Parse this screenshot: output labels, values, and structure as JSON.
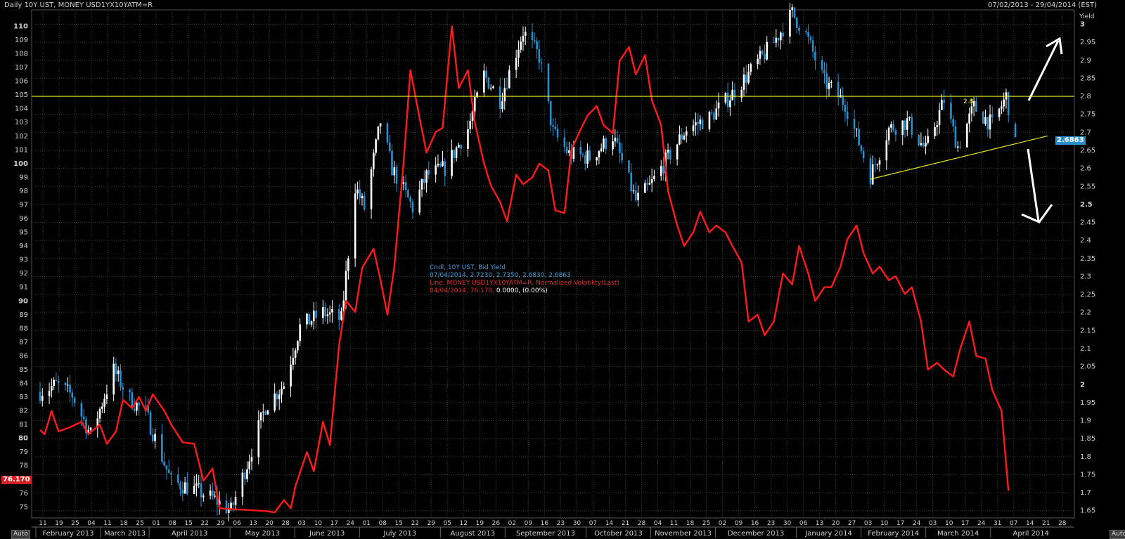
{
  "header": {
    "title": "Daily 10Y UST, MONEY USD1YX10YATM=R",
    "range": "07/02/2013 - 29/04/2014 (EST)"
  },
  "legend": {
    "line1": "Cndl, 10Y UST, Bid Yield",
    "line2": "07/04/2014, 2.7230, 2.7350, 2.6830, 2.6863",
    "line3": "Line, MONEY USD1YX10YATM=R, Normalized Volatility(Last)",
    "line4_date": "04/04/2014, 76.170,",
    "line4_rest": " 0.0000, (0.00%)"
  },
  "buttons": {
    "auto_left": "Auto",
    "auto_right": "Auto"
  },
  "tags": {
    "right_value": "2.6863",
    "left_value": "76.170",
    "level_label": "2.8"
  },
  "colors": {
    "background": "#000000",
    "grid": "#3c3c3c",
    "candle_up": "#ffffff",
    "candle_down": "#2a8fcf",
    "vol_line": "#ff1a1a",
    "level_line": "#e8e820",
    "trend_line": "#e8e820",
    "arrow": "#ffffff"
  },
  "chart_data": {
    "type": "line",
    "title": "Daily 10Y UST, MONEY USD1YX10YATM=R",
    "right_axis": {
      "label": "Yield",
      "ticks": [
        "3",
        "2.95",
        "2.9",
        "2.85",
        "2.8",
        "2.75",
        "2.7",
        "2.65",
        "2.6",
        "2.55",
        "2.5",
        "2.45",
        "2.4",
        "2.35",
        "2.3",
        "2.25",
        "2.2",
        "2.15",
        "2.1",
        "2.05",
        "2",
        "1.95",
        "1.9",
        "1.85",
        "1.8",
        "1.75",
        "1.7",
        "1.65"
      ],
      "bold_ticks": [
        "3",
        "2.5",
        "2"
      ],
      "range": [
        1.63,
        3.04
      ]
    },
    "left_axis": {
      "ticks": [
        "110",
        "109",
        "108",
        "107",
        "106",
        "105",
        "104",
        "103",
        "102",
        "101",
        "100",
        "99",
        "98",
        "97",
        "96",
        "95",
        "94",
        "93",
        "92",
        "91",
        "90",
        "89",
        "88",
        "87",
        "86",
        "85",
        "84",
        "83",
        "82",
        "81",
        "80",
        "79",
        "78",
        "77",
        "76",
        "75"
      ],
      "bold_ticks": [
        "110",
        "100",
        "90",
        "80"
      ],
      "range": [
        74.2,
        111.2
      ]
    },
    "x_ticks": [
      "11",
      "19",
      "25",
      "04",
      "11",
      "18",
      "25",
      "01",
      "08",
      "15",
      "22",
      "29",
      "06",
      "13",
      "20",
      "28",
      "03",
      "10",
      "17",
      "24",
      "01",
      "08",
      "15",
      "22",
      "29",
      "05",
      "12",
      "19",
      "26",
      "02",
      "09",
      "16",
      "23",
      "30",
      "07",
      "14",
      "21",
      "28",
      "04",
      "11",
      "18",
      "25",
      "02",
      "09",
      "16",
      "23",
      "30",
      "06",
      "13",
      "20",
      "27",
      "03",
      "10",
      "17",
      "24",
      "03",
      "10",
      "17",
      "24",
      "31",
      "07",
      "14",
      "21",
      "28"
    ],
    "months": [
      "February 2013",
      "March 2013",
      "April 2013",
      "May 2013",
      "June 2013",
      "July 2013",
      "August 2013",
      "September 2013",
      "October 2013",
      "November 2013",
      "December 2013",
      "January 2014",
      "February 2014",
      "March 2014",
      "April 2014"
    ],
    "series": [
      {
        "name": "Cndl, 10Y UST, Bid Yield",
        "kind": "candlestick",
        "x_start": "07/02/2013",
        "x_end": "07/04/2014",
        "anchors": [
          [
            "07/02/2013",
            1.98
          ],
          [
            "14/02/2013",
            2.0
          ],
          [
            "21/02/2013",
            1.97
          ],
          [
            "01/03/2013",
            1.86
          ],
          [
            "11/03/2013",
            2.04
          ],
          [
            "18/03/2013",
            1.96
          ],
          [
            "25/03/2013",
            1.92
          ],
          [
            "05/04/2013",
            1.73
          ],
          [
            "15/04/2013",
            1.71
          ],
          [
            "24/04/2013",
            1.68
          ],
          [
            "01/05/2013",
            1.65
          ],
          [
            "08/05/2013",
            1.78
          ],
          [
            "16/05/2013",
            1.94
          ],
          [
            "24/05/2013",
            2.0
          ],
          [
            "31/05/2013",
            2.16
          ],
          [
            "10/06/2013",
            2.2
          ],
          [
            "18/06/2013",
            2.18
          ],
          [
            "24/06/2013",
            2.55
          ],
          [
            "28/06/2013",
            2.49
          ],
          [
            "05/07/2013",
            2.73
          ],
          [
            "10/07/2013",
            2.6
          ],
          [
            "19/07/2013",
            2.49
          ],
          [
            "25/07/2013",
            2.58
          ],
          [
            "02/08/2013",
            2.6
          ],
          [
            "12/08/2013",
            2.71
          ],
          [
            "19/08/2013",
            2.86
          ],
          [
            "26/08/2013",
            2.79
          ],
          [
            "05/09/2013",
            2.98
          ],
          [
            "12/09/2013",
            2.91
          ],
          [
            "18/09/2013",
            2.7
          ],
          [
            "25/09/2013",
            2.64
          ],
          [
            "04/10/2013",
            2.63
          ],
          [
            "14/10/2013",
            2.69
          ],
          [
            "24/10/2013",
            2.51
          ],
          [
            "30/10/2013",
            2.55
          ],
          [
            "07/11/2013",
            2.63
          ],
          [
            "15/11/2013",
            2.71
          ],
          [
            "25/11/2013",
            2.74
          ],
          [
            "04/12/2013",
            2.8
          ],
          [
            "13/12/2013",
            2.87
          ],
          [
            "23/12/2013",
            2.95
          ],
          [
            "31/12/2013",
            3.03
          ],
          [
            "06/01/2014",
            2.97
          ],
          [
            "14/01/2014",
            2.84
          ],
          [
            "23/01/2014",
            2.78
          ],
          [
            "03/02/2014",
            2.58
          ],
          [
            "11/02/2014",
            2.71
          ],
          [
            "19/02/2014",
            2.73
          ],
          [
            "27/02/2014",
            2.65
          ],
          [
            "07/03/2014",
            2.79
          ],
          [
            "13/03/2014",
            2.66
          ],
          [
            "20/03/2014",
            2.77
          ],
          [
            "28/03/2014",
            2.72
          ],
          [
            "03/04/2014",
            2.8
          ],
          [
            "07/04/2014",
            2.6863
          ]
        ],
        "last": {
          "date": "07/04/2014",
          "open": 2.723,
          "high": 2.735,
          "low": 2.683,
          "close": 2.6863
        }
      },
      {
        "name": "Line, MONEY USD1YX10YATM=R, Normalized Volatility(Last)",
        "kind": "line",
        "points": [
          [
            "07/02/2013",
            80.6
          ],
          [
            "09/02/2013",
            80.3
          ],
          [
            "12/02/2013",
            82.0
          ],
          [
            "15/02/2013",
            80.5
          ],
          [
            "20/02/2013",
            80.8
          ],
          [
            "25/02/2013",
            81.2
          ],
          [
            "28/02/2013",
            80.3
          ],
          [
            "05/03/2013",
            81.0
          ],
          [
            "08/03/2013",
            79.6
          ],
          [
            "12/03/2013",
            80.5
          ],
          [
            "15/03/2013",
            82.8
          ],
          [
            "19/03/2013",
            82.2
          ],
          [
            "22/03/2013",
            83.0
          ],
          [
            "25/03/2013",
            82.0
          ],
          [
            "28/03/2013",
            83.2
          ],
          [
            "02/04/2013",
            82.0
          ],
          [
            "05/04/2013",
            81.0
          ],
          [
            "10/04/2013",
            79.7
          ],
          [
            "15/04/2013",
            79.6
          ],
          [
            "19/04/2013",
            76.9
          ],
          [
            "23/04/2013",
            77.8
          ],
          [
            "26/04/2013",
            74.9
          ],
          [
            "06/05/2013",
            74.8
          ],
          [
            "16/05/2013",
            74.7
          ],
          [
            "20/05/2013",
            74.6
          ],
          [
            "24/05/2013",
            75.5
          ],
          [
            "27/05/2013",
            74.9
          ],
          [
            "29/05/2013",
            76.5
          ],
          [
            "03/06/2013",
            79.0
          ],
          [
            "06/06/2013",
            77.6
          ],
          [
            "10/06/2013",
            81.2
          ],
          [
            "13/06/2013",
            79.5
          ],
          [
            "17/06/2013",
            86.8
          ],
          [
            "20/06/2013",
            90.0
          ],
          [
            "24/06/2013",
            89.2
          ],
          [
            "27/06/2013",
            92.4
          ],
          [
            "02/07/2013",
            93.8
          ],
          [
            "05/07/2013",
            91.5
          ],
          [
            "08/07/2013",
            89.0
          ],
          [
            "11/07/2013",
            92.5
          ],
          [
            "15/07/2013",
            100.0
          ],
          [
            "18/07/2013",
            106.8
          ],
          [
            "22/07/2013",
            103.3
          ],
          [
            "25/07/2013",
            100.8
          ],
          [
            "29/07/2013",
            102.3
          ],
          [
            "01/08/2013",
            102.6
          ],
          [
            "05/08/2013",
            110.0
          ],
          [
            "08/08/2013",
            105.5
          ],
          [
            "12/08/2013",
            106.8
          ],
          [
            "15/08/2013",
            103.0
          ],
          [
            "19/08/2013",
            100.0
          ],
          [
            "22/08/2013",
            98.4
          ],
          [
            "26/08/2013",
            97.2
          ],
          [
            "29/08/2013",
            95.8
          ],
          [
            "02/09/2013",
            99.2
          ],
          [
            "05/09/2013",
            98.5
          ],
          [
            "09/09/2013",
            99.0
          ],
          [
            "12/09/2013",
            100.0
          ],
          [
            "16/09/2013",
            99.5
          ],
          [
            "19/09/2013",
            96.6
          ],
          [
            "23/09/2013",
            96.4
          ],
          [
            "26/09/2013",
            101.0
          ],
          [
            "30/09/2013",
            102.5
          ],
          [
            "03/10/2013",
            103.5
          ],
          [
            "07/10/2013",
            104.2
          ],
          [
            "10/10/2013",
            102.8
          ],
          [
            "14/10/2013",
            102.2
          ],
          [
            "17/10/2013",
            107.5
          ],
          [
            "21/10/2013",
            108.5
          ],
          [
            "24/10/2013",
            106.5
          ],
          [
            "28/10/2013",
            107.9
          ],
          [
            "31/10/2013",
            104.6
          ],
          [
            "04/11/2013",
            102.8
          ],
          [
            "07/11/2013",
            98.0
          ],
          [
            "11/11/2013",
            95.5
          ],
          [
            "14/11/2013",
            94.0
          ],
          [
            "18/11/2013",
            95.0
          ],
          [
            "21/11/2013",
            96.5
          ],
          [
            "25/11/2013",
            95.0
          ],
          [
            "28/11/2013",
            95.5
          ],
          [
            "02/12/2013",
            95.0
          ],
          [
            "05/12/2013",
            94.0
          ],
          [
            "09/12/2013",
            92.8
          ],
          [
            "12/12/2013",
            88.5
          ],
          [
            "16/12/2013",
            89.0
          ],
          [
            "19/12/2013",
            87.5
          ],
          [
            "23/12/2013",
            88.5
          ],
          [
            "27/12/2013",
            92.0
          ],
          [
            "31/12/2013",
            91.2
          ],
          [
            "03/01/2014",
            94.0
          ],
          [
            "07/01/2014",
            92.0
          ],
          [
            "10/01/2014",
            90.0
          ],
          [
            "14/01/2014",
            91.0
          ],
          [
            "17/01/2014",
            91.0
          ],
          [
            "21/01/2014",
            92.5
          ],
          [
            "24/01/2014",
            94.5
          ],
          [
            "28/01/2014",
            95.5
          ],
          [
            "31/01/2014",
            93.5
          ],
          [
            "04/02/2014",
            92.0
          ],
          [
            "07/02/2014",
            92.5
          ],
          [
            "11/02/2014",
            91.5
          ],
          [
            "14/02/2014",
            91.8
          ],
          [
            "18/02/2014",
            90.5
          ],
          [
            "21/02/2014",
            91.0
          ],
          [
            "25/02/2014",
            88.5
          ],
          [
            "28/02/2014",
            85.0
          ],
          [
            "04/03/2014",
            85.5
          ],
          [
            "07/03/2014",
            85.0
          ],
          [
            "11/03/2014",
            84.5
          ],
          [
            "14/03/2014",
            86.5
          ],
          [
            "18/03/2014",
            88.5
          ],
          [
            "21/03/2014",
            86.0
          ],
          [
            "25/03/2014",
            85.8
          ],
          [
            "28/03/2014",
            83.5
          ],
          [
            "01/04/2014",
            82.0
          ],
          [
            "04/04/2014",
            76.17
          ]
        ]
      }
    ],
    "horizontal_line": {
      "value": 2.8,
      "label": "2.8"
    },
    "trend_line": {
      "from": [
        "03/02/2014",
        2.57
      ],
      "to": [
        "21/04/2014",
        2.69
      ]
    },
    "arrows": [
      "up",
      "down"
    ],
    "grid": true
  }
}
